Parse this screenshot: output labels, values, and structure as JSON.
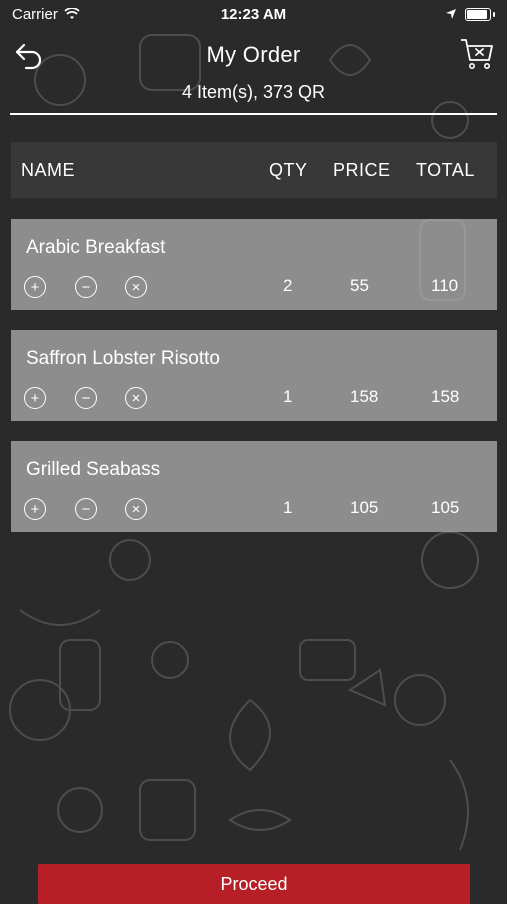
{
  "status": {
    "carrier": "Carrier",
    "time": "12:23 AM"
  },
  "header": {
    "title": "My Order",
    "summary": "4 Item(s), 373 QR"
  },
  "table": {
    "columns": {
      "name": "NAME",
      "qty": "QTY",
      "price": "PRICE",
      "total": "TOTAL"
    }
  },
  "items": [
    {
      "name": "Arabic Breakfast",
      "qty": "2",
      "price": "55",
      "total": "110"
    },
    {
      "name": "Saffron Lobster Risotto",
      "qty": "1",
      "price": "158",
      "total": "158"
    },
    {
      "name": "Grilled Seabass",
      "qty": "1",
      "price": "105",
      "total": "105"
    }
  ],
  "controls": {
    "add": "+",
    "remove": "−",
    "delete": "×"
  },
  "proceed_label": "Proceed"
}
